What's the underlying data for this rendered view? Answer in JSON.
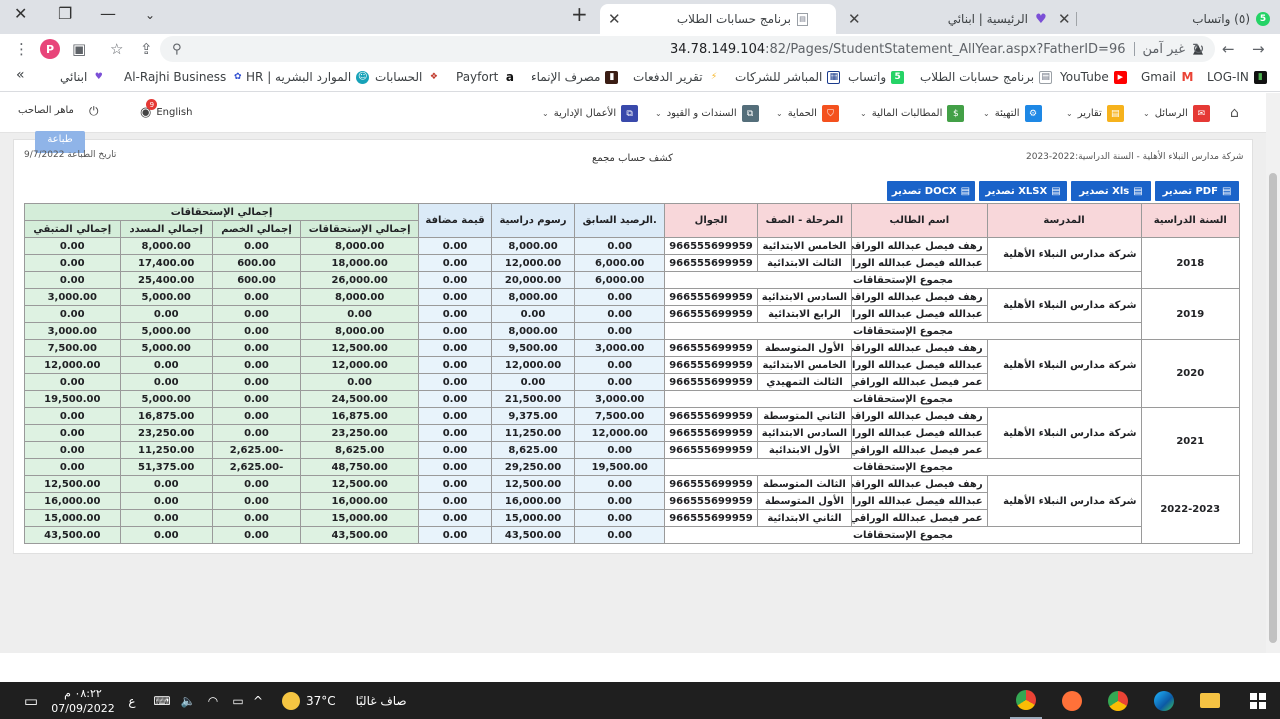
{
  "browser": {
    "tabs": [
      {
        "title": "(٥) واتساب",
        "icon": "whatsapp-icon",
        "active": false
      },
      {
        "title": "الرئيسية | ابنائي",
        "icon": "heart-icon",
        "active": false
      },
      {
        "title": "برنامج حسابات الطلاب",
        "icon": "document-icon",
        "active": true
      }
    ],
    "new_tab": "+",
    "address": {
      "warning": "غير آمن",
      "host": "34.78.149.104",
      "path": ":82/Pages/StudentStatement_AllYear.aspx?FatherID=96"
    },
    "profile_letter": "P",
    "bookmarks": [
      {
        "label": "LOG-IN",
        "icon": "log-in-icon"
      },
      {
        "label": "Gmail",
        "icon": "gmail-icon"
      },
      {
        "label": "YouTube",
        "icon": "youtube-icon"
      },
      {
        "label": "برنامج حسابات الطلاب",
        "icon": "document-icon"
      },
      {
        "label": "واتساب",
        "icon": "whatsapp-icon"
      },
      {
        "label": "المباشر للشركات",
        "icon": "bank-icon"
      },
      {
        "label": "تقرير الدفعات",
        "icon": "report-icon"
      },
      {
        "label": "مصرف الإنماء",
        "icon": "alinma-icon"
      },
      {
        "label": "Payfort",
        "icon": "amazon-icon"
      },
      {
        "label": "الحسابات",
        "icon": "accounts-icon"
      },
      {
        "label": "الموارد البشريه | HR",
        "icon": "hr-icon"
      },
      {
        "label": "Al-Rajhi Business",
        "icon": "rajhi-icon"
      },
      {
        "label": "ابنائي",
        "icon": "heart-icon"
      }
    ],
    "more": "»"
  },
  "nav": {
    "home": "home-icon",
    "items": [
      {
        "label": "الرسائل",
        "icon": "mail-icon",
        "color": "#e53935"
      },
      {
        "label": "تقارير",
        "icon": "report-icon",
        "color": "#f6b21c"
      },
      {
        "label": "التهيئة",
        "icon": "settings-icon",
        "color": "#1e88e5"
      },
      {
        "label": "المطالبات المالية",
        "icon": "money-icon",
        "color": "#43a047"
      },
      {
        "label": "الحماية",
        "icon": "shield-icon",
        "color": "#f4511e"
      },
      {
        "label": "السندات و القيود",
        "icon": "vouchers-icon",
        "color": "#546e7a"
      },
      {
        "label": "الأعمال الإدارية",
        "icon": "admin-icon",
        "color": "#3949ab"
      }
    ],
    "language": "English",
    "notification_count": "9",
    "user": "ماهر الصاحب"
  },
  "page": {
    "print": "طباعة",
    "print_date": "تاريخ الطباعة 9/7/2022",
    "title": "كشف حساب مجمع",
    "school_info": "شركة مدارس النبلاء الأهلية - السنة الدراسية:2022-2023"
  },
  "exports": [
    "تصدير PDF",
    "تصدير Xls",
    "تصدير XLSX",
    "تصدير DOCX"
  ],
  "table": {
    "headers": {
      "year": "السنة الدراسية",
      "school": "المدرسة",
      "student": "اسم الطالب",
      "stage": "المرحلة - الصف",
      "mobile": "الجوال",
      "prev_balance": ".الرصيد السابق",
      "fees": "رسوم دراسية",
      "vat": "قيمة مضافة",
      "group": "إجمالي الإستحقاقات",
      "total_due": "إجمالي الإستحقاقات",
      "discount": "إجمالي الخصم",
      "paid": "إجمالي المسدد",
      "remaining": "إجمالي المتبقي"
    },
    "total_label": "مجموع الإستحقاقات",
    "groups": [
      {
        "year": "2018",
        "school": "شركة مدارس النبلاء الأهلية",
        "rows": [
          {
            "student": "رهف فيصل عبدالله الوراقي",
            "stage": "الخامس الابتدائية",
            "mobile": "966555699959",
            "prev": "0.00",
            "fees": "8,000.00",
            "vat": "0.00",
            "due": "8,000.00",
            "disc": "0.00",
            "paid": "8,000.00",
            "rem": "0.00"
          },
          {
            "student": "عبدالله فيصل عبدالله الوراقي",
            "stage": "الثالث الابتدائية",
            "mobile": "966555699959",
            "prev": "6,000.00",
            "fees": "12,000.00",
            "vat": "0.00",
            "due": "18,000.00",
            "disc": "600.00",
            "paid": "17,400.00",
            "rem": "0.00"
          }
        ],
        "total": {
          "prev": "6,000.00",
          "fees": "20,000.00",
          "vat": "0.00",
          "due": "26,000.00",
          "disc": "600.00",
          "paid": "25,400.00",
          "rem": "0.00"
        }
      },
      {
        "year": "2019",
        "school": "شركة مدارس النبلاء الأهلية",
        "rows": [
          {
            "student": "رهف فيصل عبدالله الوراقي",
            "stage": "السادس الابتدائية",
            "mobile": "966555699959",
            "prev": "0.00",
            "fees": "8,000.00",
            "vat": "0.00",
            "due": "8,000.00",
            "disc": "0.00",
            "paid": "5,000.00",
            "rem": "3,000.00"
          },
          {
            "student": "عبدالله فيصل عبدالله الوراقي",
            "stage": "الرابع الابتدائية",
            "mobile": "966555699959",
            "prev": "0.00",
            "fees": "0.00",
            "vat": "0.00",
            "due": "0.00",
            "disc": "0.00",
            "paid": "0.00",
            "rem": "0.00"
          }
        ],
        "total": {
          "prev": "0.00",
          "fees": "8,000.00",
          "vat": "0.00",
          "due": "8,000.00",
          "disc": "0.00",
          "paid": "5,000.00",
          "rem": "3,000.00"
        }
      },
      {
        "year": "2020",
        "school": "شركة مدارس النبلاء الأهلية",
        "rows": [
          {
            "student": "رهف فيصل عبدالله الوراقي",
            "stage": "الأول المتوسطة",
            "mobile": "966555699959",
            "prev": "3,000.00",
            "fees": "9,500.00",
            "vat": "0.00",
            "due": "12,500.00",
            "disc": "0.00",
            "paid": "5,000.00",
            "rem": "7,500.00"
          },
          {
            "student": "عبدالله فيصل عبدالله الوراقي",
            "stage": "الخامس الابتدائية",
            "mobile": "966555699959",
            "prev": "0.00",
            "fees": "12,000.00",
            "vat": "0.00",
            "due": "12,000.00",
            "disc": "0.00",
            "paid": "0.00",
            "rem": "12,000.00"
          },
          {
            "student": "عمر فيصل عبدالله الوراقي",
            "stage": "الثالث التمهيدي",
            "mobile": "966555699959",
            "prev": "0.00",
            "fees": "0.00",
            "vat": "0.00",
            "due": "0.00",
            "disc": "0.00",
            "paid": "0.00",
            "rem": "0.00"
          }
        ],
        "total": {
          "prev": "3,000.00",
          "fees": "21,500.00",
          "vat": "0.00",
          "due": "24,500.00",
          "disc": "0.00",
          "paid": "5,000.00",
          "rem": "19,500.00"
        }
      },
      {
        "year": "2021",
        "school": "شركة مدارس النبلاء الأهلية",
        "rows": [
          {
            "student": "رهف فيصل عبدالله الوراقي",
            "stage": "الثاني المتوسطة",
            "mobile": "966555699959",
            "prev": "7,500.00",
            "fees": "9,375.00",
            "vat": "0.00",
            "due": "16,875.00",
            "disc": "0.00",
            "paid": "16,875.00",
            "rem": "0.00"
          },
          {
            "student": "عبدالله فيصل عبدالله الوراقي",
            "stage": "السادس الابتدائية",
            "mobile": "966555699959",
            "prev": "12,000.00",
            "fees": "11,250.00",
            "vat": "0.00",
            "due": "23,250.00",
            "disc": "0.00",
            "paid": "23,250.00",
            "rem": "0.00"
          },
          {
            "student": "عمر فيصل عبدالله الوراقي",
            "stage": "الأول الابتدائية",
            "mobile": "966555699959",
            "prev": "0.00",
            "fees": "8,625.00",
            "vat": "0.00",
            "due": "8,625.00",
            "disc": "-2,625.00",
            "paid": "11,250.00",
            "rem": "0.00"
          }
        ],
        "total": {
          "prev": "19,500.00",
          "fees": "29,250.00",
          "vat": "0.00",
          "due": "48,750.00",
          "disc": "-2,625.00",
          "paid": "51,375.00",
          "rem": "0.00"
        }
      },
      {
        "year": "2022-2023",
        "school": "شركة مدارس النبلاء الأهلية",
        "rows": [
          {
            "student": "رهف فيصل عبدالله الوراقي",
            "stage": "الثالث المتوسطة",
            "mobile": "966555699959",
            "prev": "0.00",
            "fees": "12,500.00",
            "vat": "0.00",
            "due": "12,500.00",
            "disc": "0.00",
            "paid": "0.00",
            "rem": "12,500.00"
          },
          {
            "student": "عبدالله فيصل عبدالله الوراقي",
            "stage": "الأول المتوسطة",
            "mobile": "966555699959",
            "prev": "0.00",
            "fees": "16,000.00",
            "vat": "0.00",
            "due": "16,000.00",
            "disc": "0.00",
            "paid": "0.00",
            "rem": "16,000.00"
          },
          {
            "student": "عمر فيصل عبدالله الوراقي",
            "stage": "الثاني الابتدائية",
            "mobile": "966555699959",
            "prev": "0.00",
            "fees": "15,000.00",
            "vat": "0.00",
            "due": "15,000.00",
            "disc": "0.00",
            "paid": "0.00",
            "rem": "15,000.00"
          }
        ],
        "total": {
          "prev": "0.00",
          "fees": "43,500.00",
          "vat": "0.00",
          "due": "43,500.00",
          "disc": "0.00",
          "paid": "0.00",
          "rem": "43,500.00"
        }
      }
    ]
  },
  "taskbar": {
    "time": "٠٨:٢٢ م",
    "date": "07/09/2022",
    "lang": "ع",
    "weather_temp": "37°C",
    "weather_text": "صاف غالبًا"
  }
}
